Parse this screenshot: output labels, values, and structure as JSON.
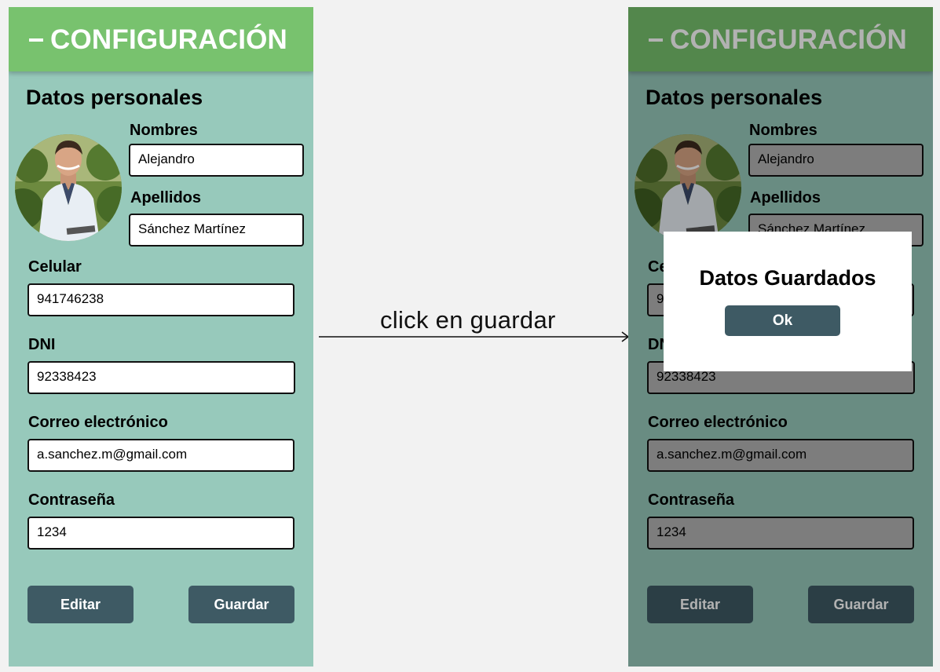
{
  "header": {
    "title": "CONFIGURACIÓN",
    "menu_icon": "menu-dash-icon"
  },
  "section_title": "Datos personales",
  "avatar": {
    "description_icon": "person-photo-icon"
  },
  "fields": {
    "nombres": {
      "label": "Nombres",
      "value": "Alejandro"
    },
    "apellidos": {
      "label": "Apellidos",
      "value": "Sánchez Martínez"
    },
    "celular": {
      "label": "Celular",
      "value": "941746238"
    },
    "dni": {
      "label": "DNI",
      "value": "92338423"
    },
    "correo": {
      "label": "Correo electrónico",
      "value": "a.sanchez.m@gmail.com"
    },
    "contrasena": {
      "label": "Contraseña",
      "value": "1234"
    }
  },
  "buttons": {
    "editar": "Editar",
    "guardar": "Guardar"
  },
  "transition": {
    "label": "click en guardar"
  },
  "modal": {
    "title": "Datos Guardados",
    "ok_label": "Ok"
  },
  "colors": {
    "background": "#f2f2f2",
    "screen": "#97c9bb",
    "header": "#78c26e",
    "button": "#3e5a64",
    "field_disabled": "#b3b3b3"
  }
}
